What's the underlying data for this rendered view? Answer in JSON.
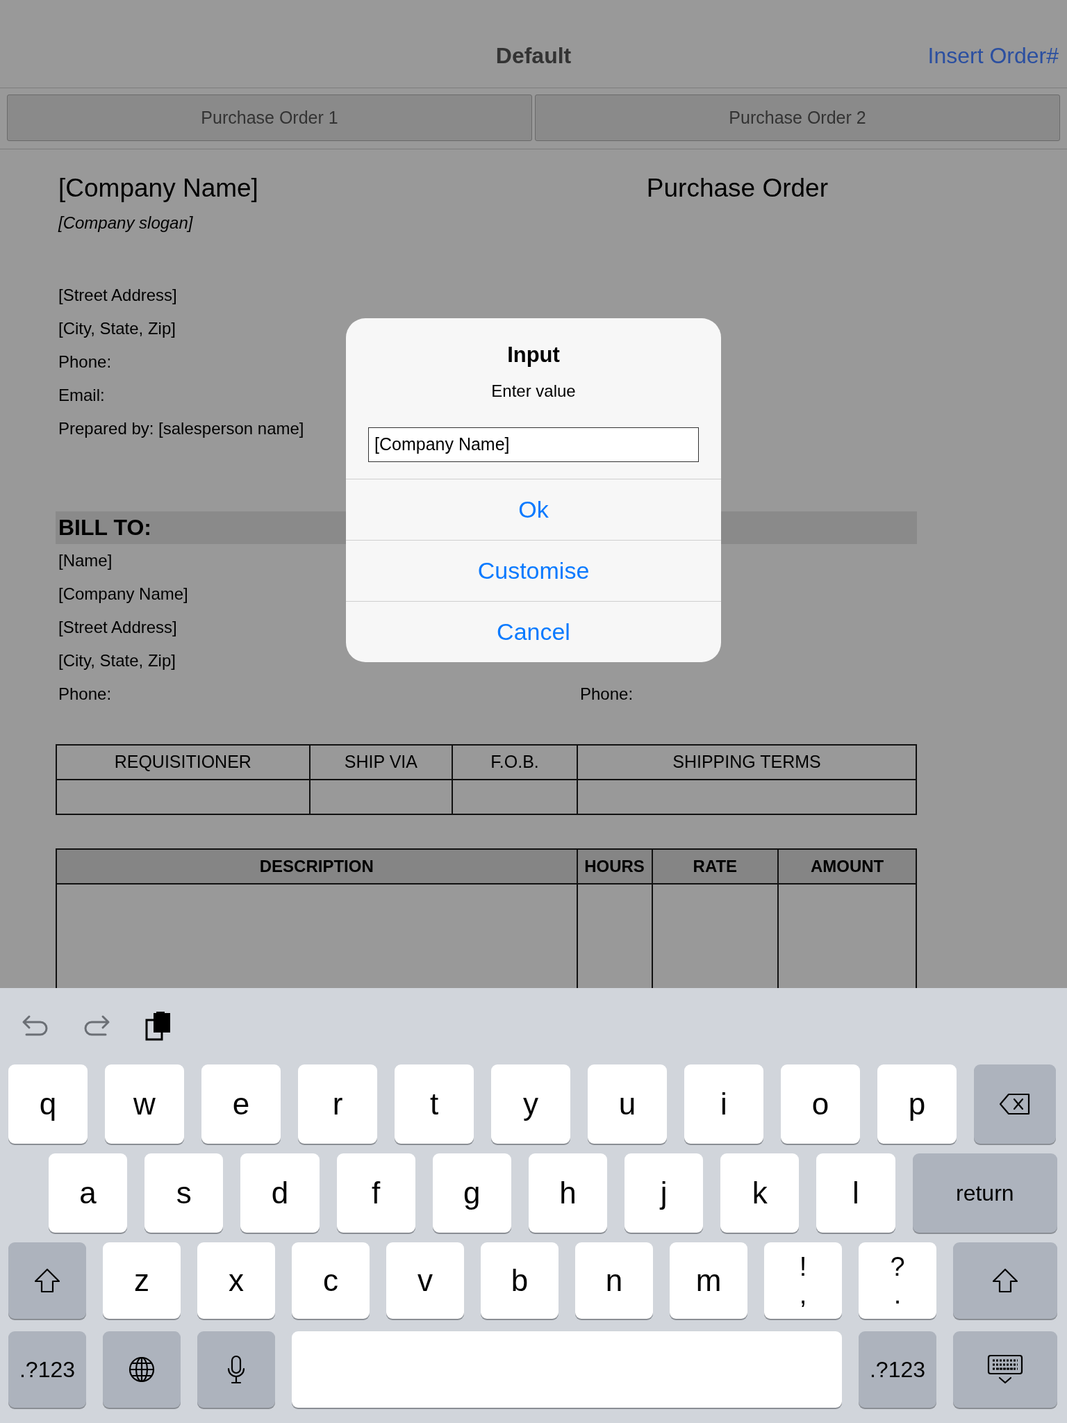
{
  "nav": {
    "title": "Default",
    "action": "Insert Order#"
  },
  "segments": [
    {
      "label": "Purchase Order 1"
    },
    {
      "label": "Purchase Order 2"
    }
  ],
  "document": {
    "company_name": "[Company Name]",
    "doc_title": "Purchase Order",
    "slogan": "[Company slogan]",
    "sender_lines": [
      "[Street Address]",
      "[City, State,  Zip]",
      "Phone:",
      "Email:",
      "Prepared by: [salesperson name]"
    ],
    "bill_to": {
      "heading": "BILL TO:",
      "lines": [
        "[Name]",
        "[Company Name]",
        "[Street Address]",
        "[City, State,  Zip]",
        "Phone:"
      ]
    },
    "ship_to": {
      "lines": [
        "Phone:"
      ]
    },
    "shipping_table": {
      "columns": [
        "REQUISITIONER",
        "SHIP VIA",
        "F.O.B.",
        "SHIPPING TERMS"
      ]
    },
    "items_table": {
      "columns": [
        "DESCRIPTION",
        "HOURS",
        "RATE",
        "AMOUNT"
      ]
    }
  },
  "dialog": {
    "title": "Input",
    "message": "Enter value",
    "value": "[Company Name]",
    "buttons": [
      "Ok",
      "Customise",
      "Cancel"
    ]
  },
  "keyboard": {
    "rows": [
      {
        "keys": [
          {
            "kind": "letter",
            "label": "q"
          },
          {
            "kind": "letter",
            "label": "w"
          },
          {
            "kind": "letter",
            "label": "e"
          },
          {
            "kind": "letter",
            "label": "r"
          },
          {
            "kind": "letter",
            "label": "t"
          },
          {
            "kind": "letter",
            "label": "y"
          },
          {
            "kind": "letter",
            "label": "u"
          },
          {
            "kind": "letter",
            "label": "i"
          },
          {
            "kind": "letter",
            "label": "o"
          },
          {
            "kind": "letter",
            "label": "p"
          },
          {
            "kind": "backspace"
          }
        ]
      },
      {
        "keys": [
          {
            "kind": "letter",
            "label": "a"
          },
          {
            "kind": "letter",
            "label": "s"
          },
          {
            "kind": "letter",
            "label": "d"
          },
          {
            "kind": "letter",
            "label": "f"
          },
          {
            "kind": "letter",
            "label": "g"
          },
          {
            "kind": "letter",
            "label": "h"
          },
          {
            "kind": "letter",
            "label": "j"
          },
          {
            "kind": "letter",
            "label": "k"
          },
          {
            "kind": "letter",
            "label": "l"
          },
          {
            "kind": "return",
            "label": "return"
          }
        ]
      },
      {
        "keys": [
          {
            "kind": "shift"
          },
          {
            "kind": "letter",
            "label": "z"
          },
          {
            "kind": "letter",
            "label": "x"
          },
          {
            "kind": "letter",
            "label": "c"
          },
          {
            "kind": "letter",
            "label": "v"
          },
          {
            "kind": "letter",
            "label": "b"
          },
          {
            "kind": "letter",
            "label": "n"
          },
          {
            "kind": "letter",
            "label": "m"
          },
          {
            "kind": "punct",
            "top": "!",
            "bottom": ","
          },
          {
            "kind": "punct",
            "top": "?",
            "bottom": "."
          },
          {
            "kind": "shift"
          }
        ]
      },
      {
        "keys": [
          {
            "kind": "numbers",
            "label": ".?123"
          },
          {
            "kind": "globe"
          },
          {
            "kind": "mic"
          },
          {
            "kind": "space"
          },
          {
            "kind": "numbers",
            "label": ".?123"
          },
          {
            "kind": "hide"
          }
        ]
      }
    ]
  }
}
